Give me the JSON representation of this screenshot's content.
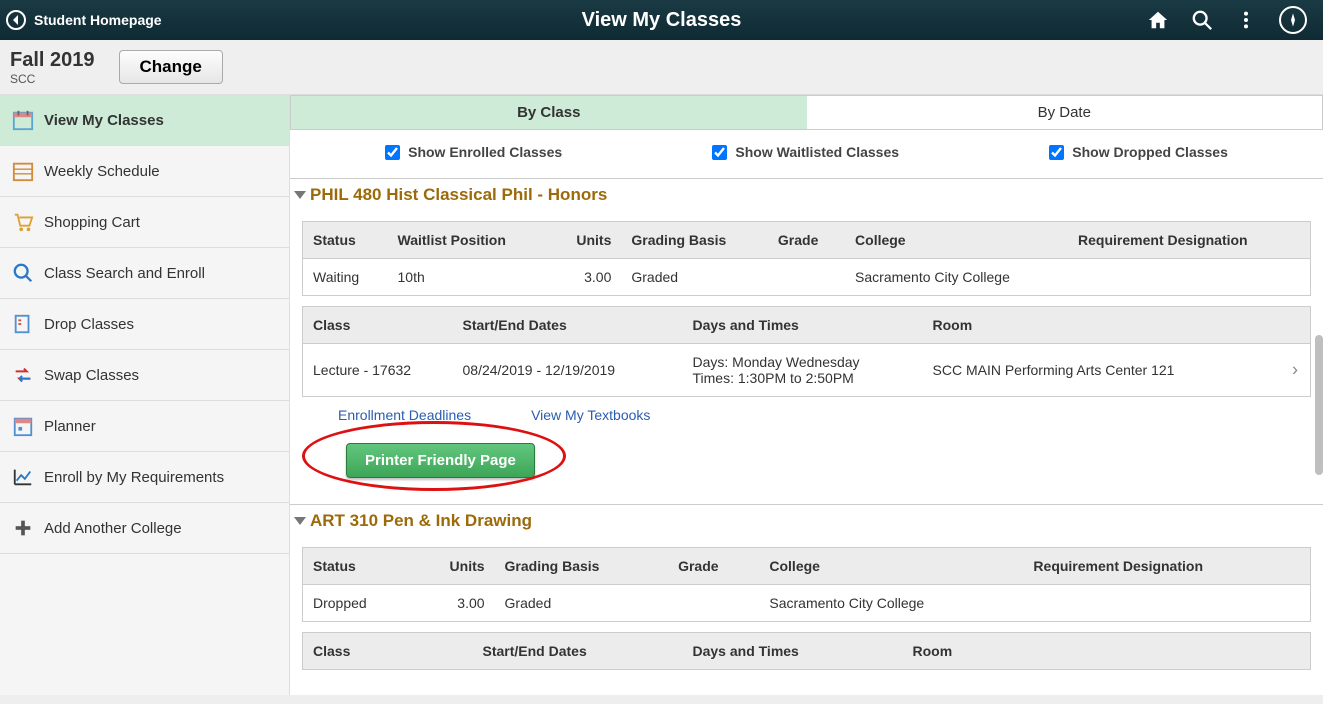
{
  "header": {
    "back_label": "Student Homepage",
    "title": "View My Classes"
  },
  "term": {
    "name": "Fall 2019",
    "college_short": "SCC",
    "change_label": "Change"
  },
  "sidebar": {
    "items": [
      {
        "label": "View My Classes",
        "active": true
      },
      {
        "label": "Weekly Schedule"
      },
      {
        "label": "Shopping Cart"
      },
      {
        "label": "Class Search and Enroll"
      },
      {
        "label": "Drop Classes"
      },
      {
        "label": "Swap Classes"
      },
      {
        "label": "Planner"
      },
      {
        "label": "Enroll by My Requirements"
      },
      {
        "label": "Add Another College"
      }
    ]
  },
  "tabs": {
    "by_class": "By Class",
    "by_date": "By Date"
  },
  "checks": {
    "enrolled": "Show Enrolled Classes",
    "waitlisted": "Show Waitlisted Classes",
    "dropped": "Show Dropped Classes"
  },
  "courses": [
    {
      "title": "PHIL 480 Hist Classical Phil - Honors",
      "status_headers": {
        "status": "Status",
        "wlpos": "Waitlist Position",
        "units": "Units",
        "grading": "Grading Basis",
        "grade": "Grade",
        "college": "College",
        "reqdes": "Requirement Designation"
      },
      "status_row": {
        "status": "Waiting",
        "wlpos": "10th",
        "units": "3.00",
        "grading": "Graded",
        "grade": "",
        "college": "Sacramento City College",
        "reqdes": ""
      },
      "sched_headers": {
        "class": "Class",
        "dates": "Start/End Dates",
        "days": "Days and Times",
        "room": "Room"
      },
      "sched_row": {
        "class": "Lecture - 17632",
        "dates": "08/24/2019 - 12/19/2019",
        "days_line1": "Days: Monday Wednesday",
        "days_line2": "Times: 1:30PM to 2:50PM",
        "room": "SCC MAIN Performing Arts Center 121"
      },
      "links": {
        "deadlines": "Enrollment Deadlines",
        "textbooks": "View My Textbooks"
      },
      "printer_label": "Printer Friendly Page"
    },
    {
      "title": "ART 310 Pen & Ink Drawing",
      "status_headers": {
        "status": "Status",
        "units": "Units",
        "grading": "Grading Basis",
        "grade": "Grade",
        "college": "College",
        "reqdes": "Requirement Designation"
      },
      "status_row": {
        "status": "Dropped",
        "units": "3.00",
        "grading": "Graded",
        "grade": "",
        "college": "Sacramento City College",
        "reqdes": ""
      },
      "sched_headers": {
        "class": "Class",
        "dates": "Start/End Dates",
        "days": "Days and Times",
        "room": "Room"
      }
    }
  ]
}
